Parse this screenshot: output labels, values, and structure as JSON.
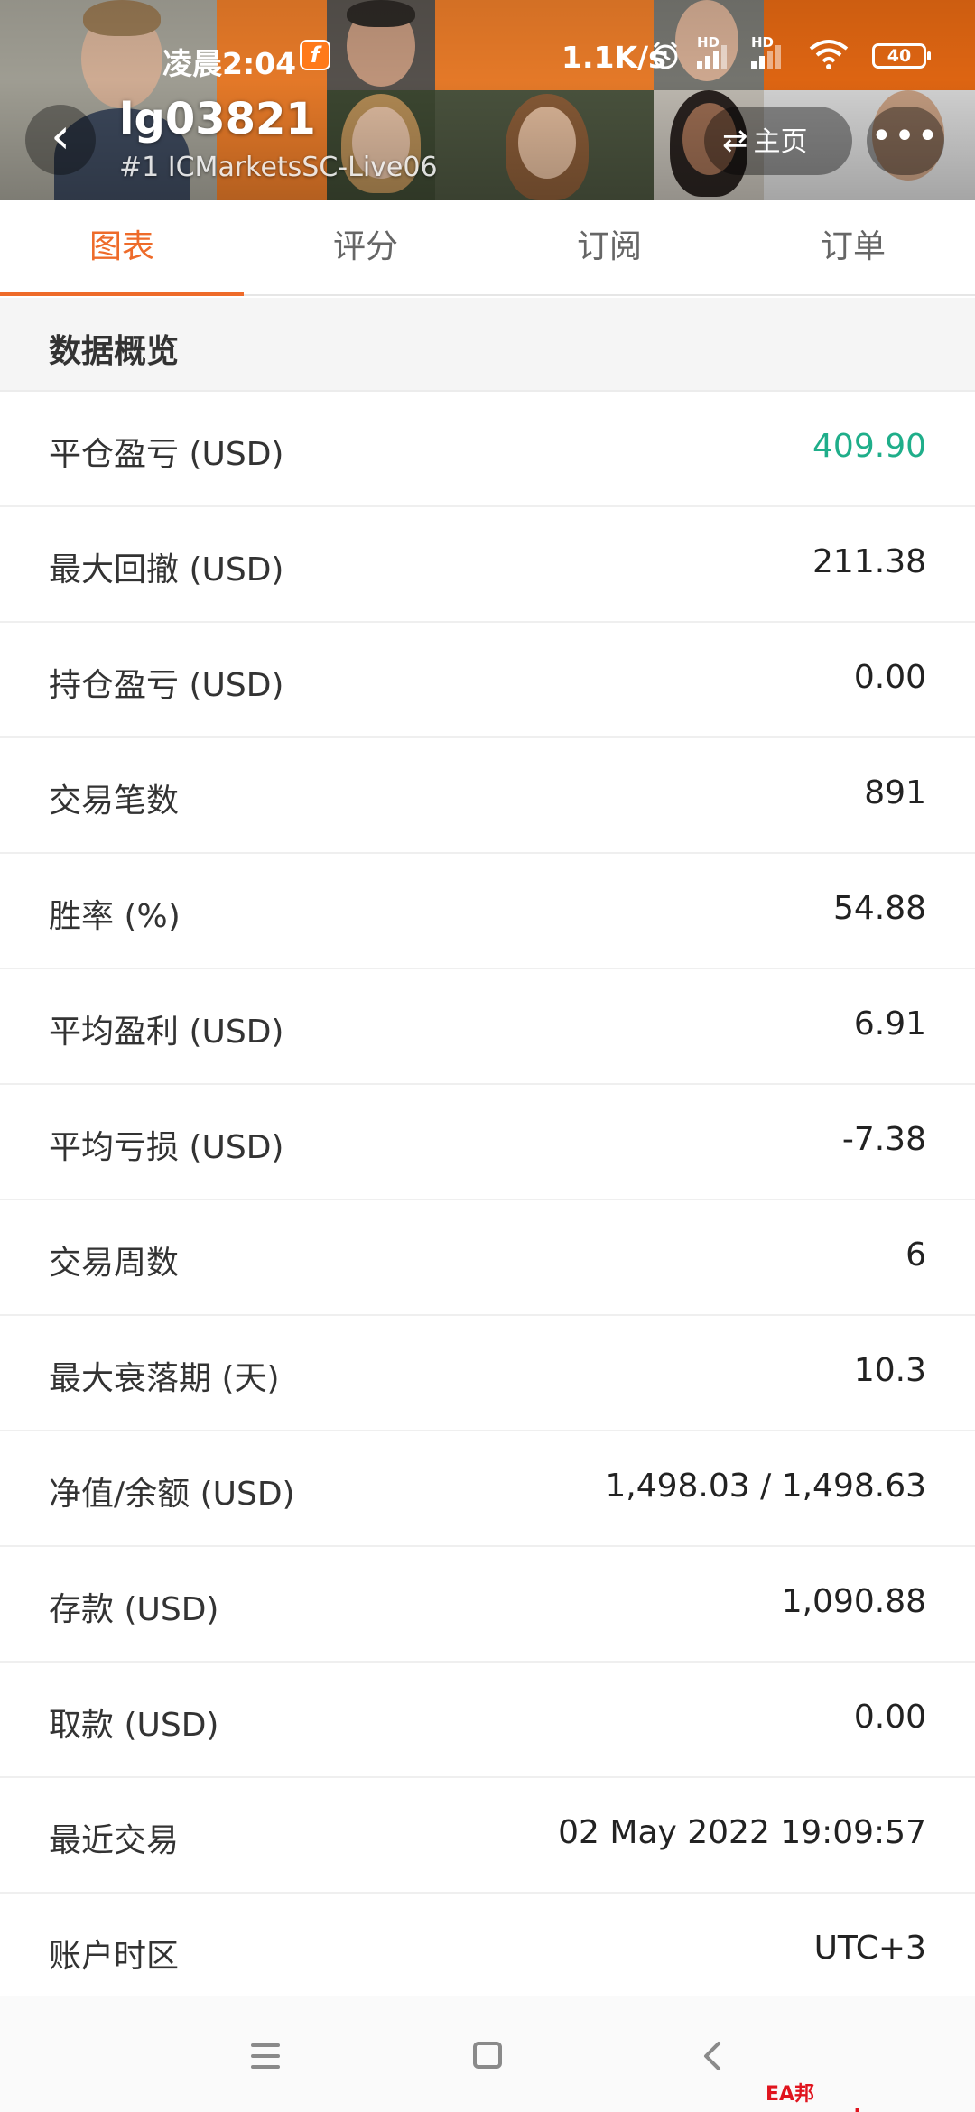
{
  "status_bar": {
    "time": "凌晨2:04",
    "app_badge": "f",
    "network_speed": "1.1K/s",
    "alarm_icon": "alarm-icon",
    "hd_label": "HD",
    "battery": "40"
  },
  "header": {
    "account_name": "lg03821",
    "account_sub": "#1  ICMarketsSC-Live06",
    "home_label": "主页",
    "more_glyph": "•••",
    "back_glyph": "‹"
  },
  "tabs": [
    {
      "label": "图表",
      "active": true
    },
    {
      "label": "评分",
      "active": false
    },
    {
      "label": "订阅",
      "active": false
    },
    {
      "label": "订单",
      "active": false
    }
  ],
  "section_title": "数据概览",
  "rows": [
    {
      "label": "平仓盈亏 (USD)",
      "value": "409.90",
      "positive": true
    },
    {
      "label": "最大回撤 (USD)",
      "value": "211.38"
    },
    {
      "label": "持仓盈亏 (USD)",
      "value": "0.00"
    },
    {
      "label": "交易笔数",
      "value": "891"
    },
    {
      "label": "胜率 (%)",
      "value": "54.88"
    },
    {
      "label": "平均盈利 (USD)",
      "value": "6.91"
    },
    {
      "label": "平均亏损 (USD)",
      "value": "-7.38"
    },
    {
      "label": "交易周数",
      "value": "6"
    },
    {
      "label": "最大衰落期 (天)",
      "value": "10.3"
    },
    {
      "label": "净值/余额 (USD)",
      "value": "1,498.03 / 1,498.63"
    },
    {
      "label": "存款 (USD)",
      "value": "1,090.88"
    },
    {
      "label": "取款 (USD)",
      "value": "0.00"
    },
    {
      "label": "最近交易",
      "value": "02 May 2022 19:09:57"
    },
    {
      "label": "账户时区",
      "value": "UTC+3"
    }
  ],
  "watermark": "EA邦www.eabang.com",
  "colors": {
    "accent": "#ee6b2a",
    "positive": "#1fae8a",
    "banner_orange": "#f07f2a"
  }
}
